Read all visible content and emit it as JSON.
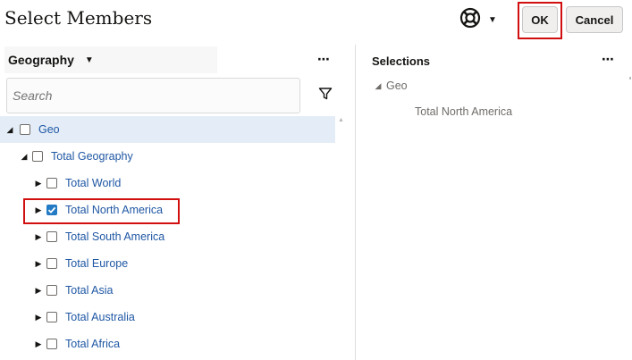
{
  "dialog": {
    "title": "Select Members",
    "ok_label": "OK",
    "cancel_label": "Cancel",
    "help_icon": "lifebuoy-icon"
  },
  "left_panel": {
    "dimension_label": "Geography",
    "more_icon": "⋯",
    "search_placeholder": "Search",
    "filter_icon": "filter-icon"
  },
  "tree": [
    {
      "label": "Geo",
      "level": 0,
      "expanded": true,
      "checked": false,
      "selected": true
    },
    {
      "label": "Total Geography",
      "level": 1,
      "expanded": true,
      "checked": false
    },
    {
      "label": "Total World",
      "level": 2,
      "expanded": false,
      "checked": false
    },
    {
      "label": "Total North America",
      "level": 2,
      "expanded": false,
      "checked": true
    },
    {
      "label": "Total South America",
      "level": 2,
      "expanded": false,
      "checked": false
    },
    {
      "label": "Total Europe",
      "level": 2,
      "expanded": false,
      "checked": false
    },
    {
      "label": "Total Asia",
      "level": 2,
      "expanded": false,
      "checked": false
    },
    {
      "label": "Total Australia",
      "level": 2,
      "expanded": false,
      "checked": false
    },
    {
      "label": "Total Africa",
      "level": 2,
      "expanded": false,
      "checked": false
    }
  ],
  "right_panel": {
    "title": "Selections",
    "more_icon": "⋯",
    "parent": "Geo",
    "members": [
      "Total North America"
    ]
  },
  "colors": {
    "highlight_border": "#d20f0f",
    "link_text": "#1f57a4",
    "checkbox_checked": "#227bc4",
    "selected_row": "#e4edf7"
  }
}
